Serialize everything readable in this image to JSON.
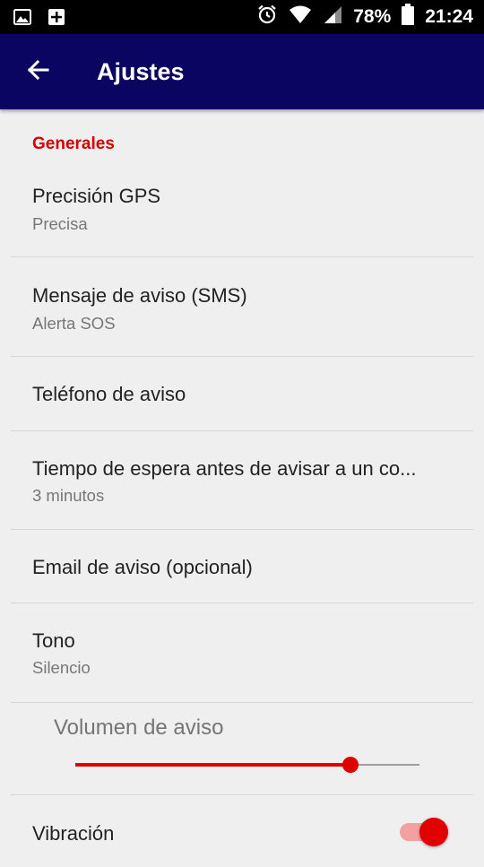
{
  "status_bar": {
    "battery_percent": "78%",
    "time": "21:24",
    "icons": [
      "image-icon",
      "add-box-icon",
      "alarm-icon",
      "wifi-icon",
      "signal-icon",
      "battery-icon"
    ]
  },
  "app_bar": {
    "title": "Ajustes",
    "back_icon": "arrow-back-icon"
  },
  "settings": {
    "section_header": "Generales",
    "items": [
      {
        "title": "Precisión GPS",
        "summary": "Precisa"
      },
      {
        "title": "Mensaje de aviso (SMS)",
        "summary": "Alerta SOS"
      },
      {
        "title": "Teléfono de aviso",
        "summary": ""
      },
      {
        "title": "Tiempo de espera antes de avisar a un co...",
        "summary": "3 minutos"
      },
      {
        "title": "Email de aviso (opcional)",
        "summary": ""
      },
      {
        "title": "Tono",
        "summary": "Silencio"
      }
    ],
    "volume": {
      "label": "Volumen de aviso",
      "level": 0.8
    },
    "vibration": {
      "label": "Vibración",
      "enabled": true
    }
  },
  "colors": {
    "app_bar": "#0a0560",
    "accent": "#e00000",
    "background": "#efefef",
    "switch_track": "#f3a0a0"
  }
}
